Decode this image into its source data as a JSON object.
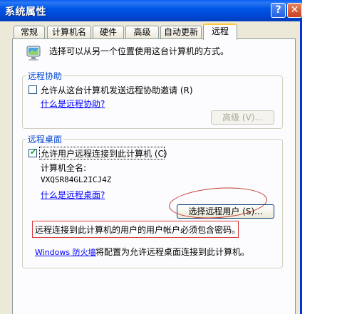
{
  "window": {
    "title": "系统属性",
    "help_button": "?",
    "close_button": "✕"
  },
  "tabs": [
    {
      "label": "常规"
    },
    {
      "label": "计算机名"
    },
    {
      "label": "硬件"
    },
    {
      "label": "高级"
    },
    {
      "label": "自动更新"
    },
    {
      "label": "远程",
      "active": true
    }
  ],
  "intro_text": "选择可以从另一个位置使用这台计算机的方式。",
  "remote_assistance": {
    "group_label": "远程协助",
    "checkbox_label": "允许从这台计算机发送远程协助邀请 (R)",
    "checked": false,
    "help_link": "什么是远程协助?",
    "advanced_button": "高级 (V)..."
  },
  "remote_desktop": {
    "group_label": "远程桌面",
    "checkbox_label": "允许用户远程连接到此计算机 (C)",
    "checked": true,
    "computer_name_label": "计算机全名:",
    "computer_name_value": "VXQSR84GL2ICJ4Z",
    "help_link": "什么是远程桌面?",
    "select_users_button": "选择远程用户 (S)...",
    "password_note": "远程连接到此计算机的用户的用户帐户必须包含密码。",
    "firewall_link": "Windows 防火墙",
    "firewall_text": "将配置为允许远程桌面连接到此计算机。"
  },
  "colors": {
    "titlebar": "#0055e5",
    "group_label": "#0046d5",
    "link": "#0000ff",
    "annotation": "#d63a3a"
  }
}
